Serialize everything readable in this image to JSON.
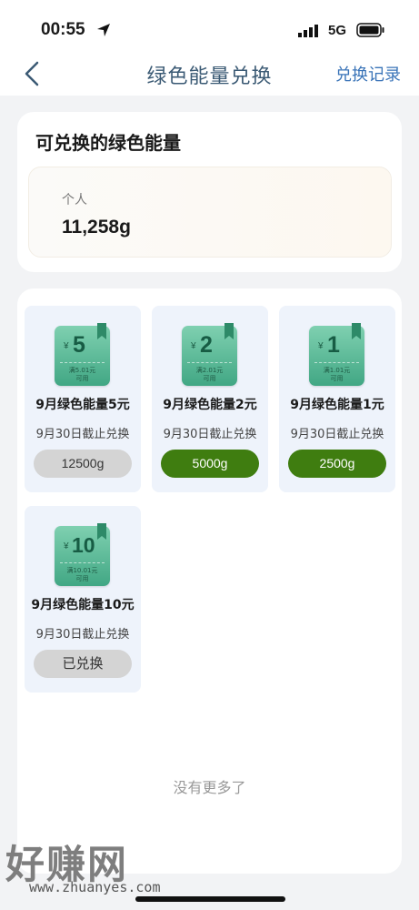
{
  "status": {
    "time": "00:55",
    "network": "5G"
  },
  "nav": {
    "title": "绿色能量兑换",
    "right_link": "兑换记录"
  },
  "energy": {
    "title": "可兑换的绿色能量",
    "label": "个人",
    "value": "11,258g"
  },
  "rewards": [
    {
      "amount": "5",
      "yen": "¥",
      "condition_1": "满5.01元",
      "condition_2": "可用",
      "name": "9月绿色能量5元",
      "deadline": "9月30日截止兑换",
      "button": "12500g",
      "button_state": "disabled"
    },
    {
      "amount": "2",
      "yen": "¥",
      "condition_1": "满2.01元",
      "condition_2": "可用",
      "name": "9月绿色能量2元",
      "deadline": "9月30日截止兑换",
      "button": "5000g",
      "button_state": "active"
    },
    {
      "amount": "1",
      "yen": "¥",
      "condition_1": "满1.01元",
      "condition_2": "可用",
      "name": "9月绿色能量1元",
      "deadline": "9月30日截止兑换",
      "button": "2500g",
      "button_state": "active"
    },
    {
      "amount": "10",
      "yen": "¥",
      "condition_1": "满10.01元",
      "condition_2": "可用",
      "name": "9月绿色能量10元",
      "deadline": "9月30日截止兑换",
      "button": "已兑换",
      "button_state": "redeemed"
    }
  ],
  "footer": {
    "no_more": "没有更多了"
  },
  "watermark": {
    "big": "好赚网",
    "small": "www.zhuanyes.com"
  },
  "colors": {
    "accent_green": "#3f7d10",
    "link_blue": "#3a74b8",
    "disabled_gray": "#d4d4d4"
  }
}
